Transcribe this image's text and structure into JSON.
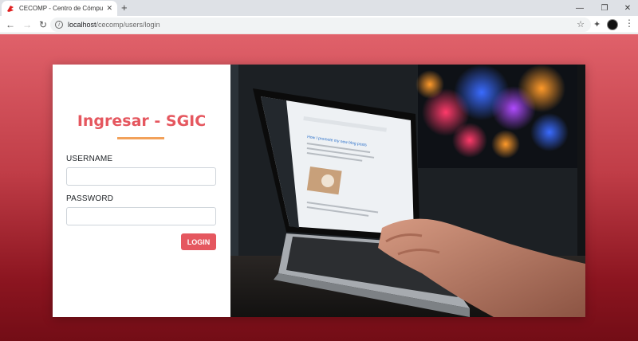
{
  "browser": {
    "tab_title": "CECOMP - Centro de Cómputo U",
    "new_tab_label": "+",
    "url_host": "localhost",
    "url_path": "/cecomp/users/login"
  },
  "login": {
    "title": "Ingresar - SGIC",
    "username_label": "USERNAME",
    "username_value": "",
    "password_label": "PASSWORD",
    "password_value": "",
    "login_button": "LOGIN"
  },
  "photo": {
    "description_icon": "laptop-photo",
    "screen_heading": "How I promote my new blog posts"
  },
  "colors": {
    "accent": "#e5575f",
    "underline": "#f2a15a",
    "background_top": "#e0616a",
    "background_bottom": "#730d16"
  }
}
